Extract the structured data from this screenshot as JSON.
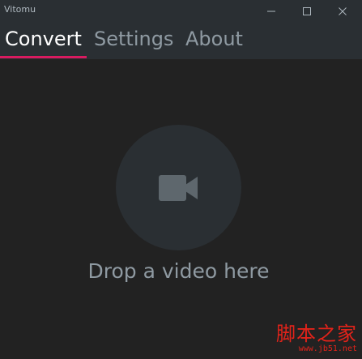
{
  "window": {
    "title": "Vitomu",
    "controls": {
      "minimize_icon": "minimize-icon",
      "maximize_icon": "maximize-icon",
      "close_icon": "close-icon"
    }
  },
  "tabs": [
    {
      "label": "Convert",
      "active": true
    },
    {
      "label": "Settings",
      "active": false
    },
    {
      "label": "About",
      "active": false
    }
  ],
  "drop_zone": {
    "icon": "video-camera-icon",
    "text": "Drop a video here"
  },
  "watermark": {
    "chinese": "脚本之家",
    "url": "www.jb51.net"
  },
  "colors": {
    "background": "#222222",
    "header": "#2a2f33",
    "accent": "#d81b60",
    "circle": "#2a2f33",
    "icon": "#5e676d",
    "inactive_text": "#8f9aa2",
    "watermark": "#e2231a"
  }
}
